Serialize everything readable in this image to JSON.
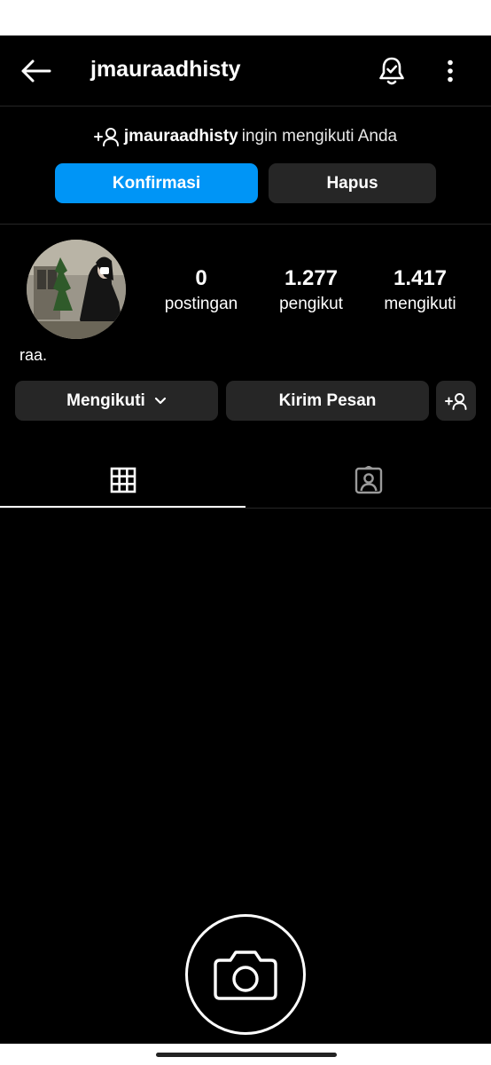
{
  "header": {
    "username": "jmauraadhisty",
    "icons": [
      "back-arrow-icon",
      "notification-bell-icon",
      "more-vertical-icon"
    ]
  },
  "follow_request": {
    "prefix_icon": "add-person-icon",
    "username": "jmauraadhisty",
    "message": "ingin mengikuti Anda",
    "confirm_label": "Konfirmasi",
    "delete_label": "Hapus",
    "confirm_color": "#0095f6"
  },
  "profile": {
    "posts_count": "0",
    "posts_label": "postingan",
    "followers_count": "1.277",
    "followers_label": "pengikut",
    "following_count": "1.417",
    "following_label": "mengikuti",
    "bio": "raa."
  },
  "actions": {
    "following_label": "Mengikuti",
    "message_label": "Kirim Pesan",
    "add_icon": "add-person-icon"
  },
  "tabs": [
    {
      "name": "grid",
      "icon": "grid-icon",
      "active": true
    },
    {
      "name": "tagged",
      "icon": "tagged-person-icon",
      "active": false
    }
  ],
  "empty_state": {
    "icon": "camera-icon"
  }
}
